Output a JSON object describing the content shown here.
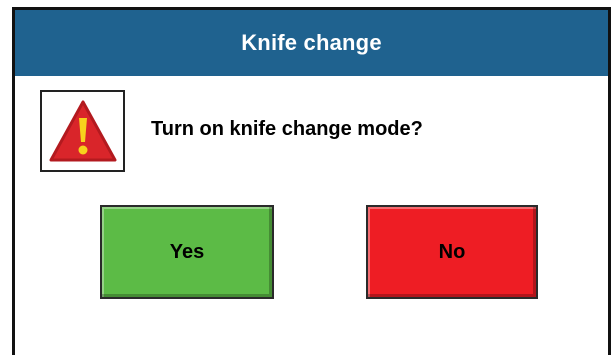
{
  "dialog": {
    "title": "Knife change",
    "message": "Turn on knife change mode?",
    "icon": "warning-icon",
    "buttons": {
      "yes_label": "Yes",
      "no_label": "No"
    }
  },
  "colors": {
    "titlebar": "#1f628f",
    "yes": "#5cbb46",
    "no": "#ee1d24",
    "warning": "#d9252a",
    "warning_mark": "#f7d21c"
  }
}
